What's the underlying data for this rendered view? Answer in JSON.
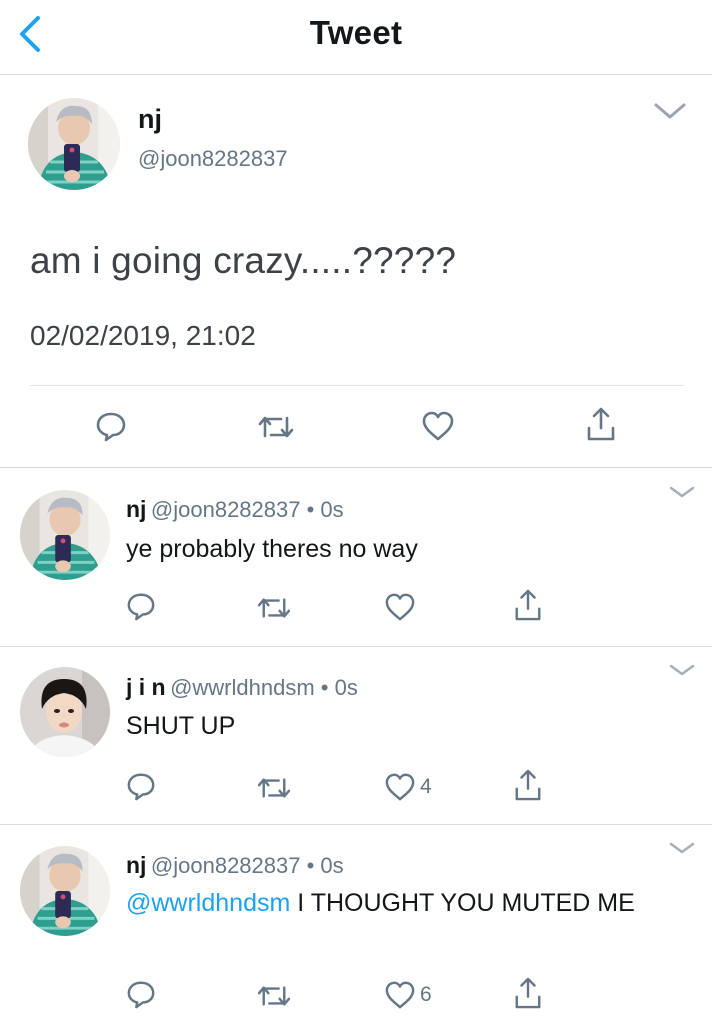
{
  "header": {
    "title": "Tweet"
  },
  "main_tweet": {
    "name": "nj",
    "handle": "@joon8282837",
    "text": "am i going crazy.....?????",
    "timestamp": "02/02/2019, 21:02"
  },
  "replies": [
    {
      "name": "nj",
      "meta": "@joon8282837 • 0s",
      "mention": "",
      "text": "ye probably theres no way",
      "like_count": ""
    },
    {
      "name": "j i n",
      "meta": "@wwrldhndsm • 0s",
      "mention": "",
      "text": "SHUT UP",
      "like_count": "4"
    },
    {
      "name": "nj",
      "meta": "@joon8282837 • 0s",
      "mention": "@wwrldhndsm",
      "text": " I THOUGHT YOU MUTED ME",
      "like_count": "6"
    }
  ],
  "colors": {
    "accent": "#1da1f2",
    "icon_gray": "#657786"
  },
  "icons": [
    "back-chevron-icon",
    "reply-icon",
    "retweet-icon",
    "like-icon",
    "share-icon",
    "chevron-down-icon"
  ]
}
